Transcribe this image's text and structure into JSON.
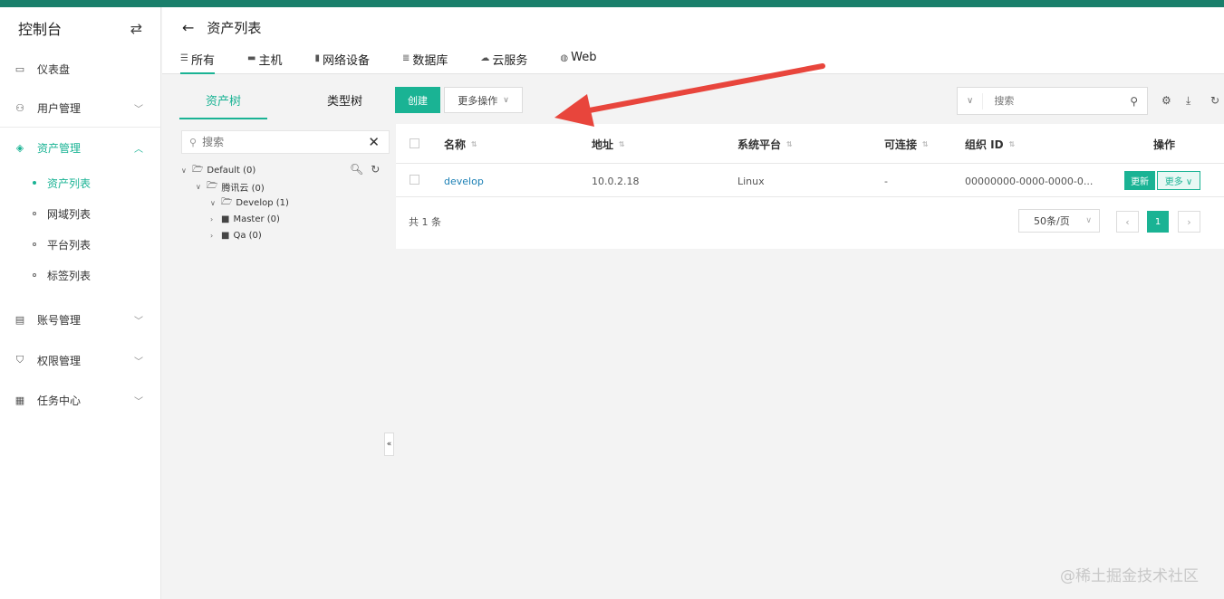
{
  "sidebar": {
    "title": "控制台",
    "items": [
      {
        "label": "仪表盘"
      },
      {
        "label": "用户管理"
      },
      {
        "label": "资产管理"
      },
      {
        "label": "账号管理"
      },
      {
        "label": "权限管理"
      },
      {
        "label": "任务中心"
      }
    ],
    "sub_items": [
      {
        "label": "资产列表"
      },
      {
        "label": "网域列表"
      },
      {
        "label": "平台列表"
      },
      {
        "label": "标签列表"
      }
    ]
  },
  "header": {
    "title": "资产列表",
    "tabs": [
      {
        "label": "所有"
      },
      {
        "label": "主机"
      },
      {
        "label": "网络设备"
      },
      {
        "label": "数据库"
      },
      {
        "label": "云服务"
      },
      {
        "label": "Web"
      }
    ]
  },
  "tree": {
    "tabs": [
      {
        "label": "资产树"
      },
      {
        "label": "类型树"
      }
    ],
    "search_placeholder": "搜索",
    "nodes": [
      {
        "label": "Default (0)"
      },
      {
        "label": "腾讯云 (0)"
      },
      {
        "label": "Develop (1)"
      },
      {
        "label": "Master (0)"
      },
      {
        "label": "Qa (0)"
      }
    ]
  },
  "toolbar": {
    "create_label": "创建",
    "more_label": "更多操作",
    "search_placeholder": "搜索"
  },
  "table": {
    "columns": [
      "名称",
      "地址",
      "系统平台",
      "可连接",
      "组织 ID",
      "操作"
    ],
    "rows": [
      {
        "name": "develop",
        "address": "10.0.2.18",
        "platform": "Linux",
        "connectable": "-",
        "org_id": "00000000-0000-0000-0..."
      }
    ],
    "update_label": "更新",
    "row_more_label": "更多",
    "total_label": "共 1 条",
    "page_size": "50条/页",
    "current_page": "1"
  },
  "watermark": "@稀土掘金技术社区",
  "colors": {
    "accent": "#1ab394",
    "topbar": "#1a7f6b",
    "arrow": "#e8453c",
    "link": "#1a7fb4"
  }
}
